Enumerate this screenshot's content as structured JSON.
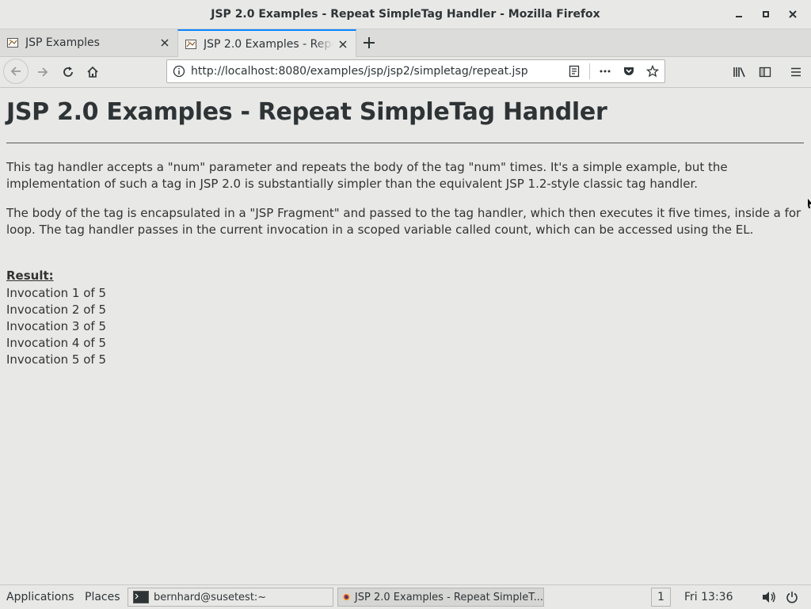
{
  "window": {
    "title": "JSP 2.0 Examples - Repeat SimpleTag Handler - Mozilla Firefox"
  },
  "tabs": [
    {
      "label": "JSP Examples",
      "icon": "page-icon",
      "active": false
    },
    {
      "label": "JSP 2.0 Examples - Repeat SimpleTag Handler",
      "icon": "page-icon",
      "active": true
    }
  ],
  "navbar": {
    "url": "http://localhost:8080/examples/jsp/jsp2/simpletag/repeat.jsp"
  },
  "page": {
    "heading": "JSP 2.0 Examples - Repeat SimpleTag Handler",
    "paragraph1": "This tag handler accepts a \"num\" parameter and repeats the body of the tag \"num\" times. It's a simple example, but the implementation of such a tag in JSP 2.0 is substantially simpler than the equivalent JSP 1.2-style classic tag handler.",
    "paragraph2": "The body of the tag is encapsulated in a \"JSP Fragment\" and passed to the tag handler, which then executes it five times, inside a for loop. The tag handler passes in the current invocation in a scoped variable called count, which can be accessed using the EL.",
    "result_label": "Result:",
    "invocations": [
      "Invocation 1 of 5",
      "Invocation 2 of 5",
      "Invocation 3 of 5",
      "Invocation 4 of 5",
      "Invocation 5 of 5"
    ]
  },
  "taskbar": {
    "applications": "Applications",
    "places": "Places",
    "terminal_window": "bernhard@susetest:~",
    "firefox_window": "JSP 2.0 Examples - Repeat SimpleT...",
    "workspace": "1",
    "clock": "Fri 13:36"
  },
  "colors": {
    "accent": "#0a84ff",
    "chrome_bg": "#e8e8e7",
    "text": "#2e3436"
  }
}
